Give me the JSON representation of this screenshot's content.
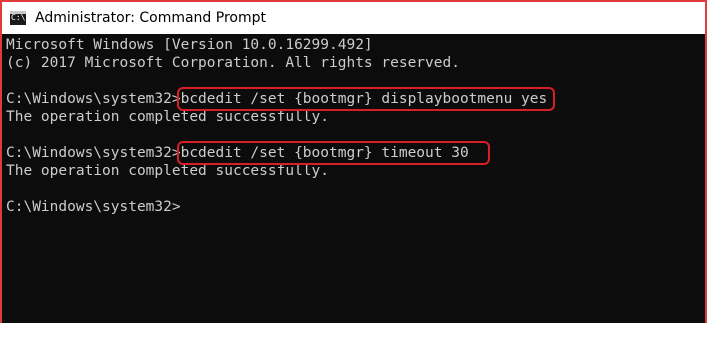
{
  "window": {
    "title": "Administrator: Command Prompt",
    "icon": "cmd-icon",
    "icon_glyph": "C:\\"
  },
  "console": {
    "lines": [
      "Microsoft Windows [Version 10.0.16299.492]",
      "(c) 2017 Microsoft Corporation. All rights reserved.",
      "",
      "C:\\Windows\\system32>bcdedit /set {bootmgr} displaybootmenu yes",
      "The operation completed successfully.",
      "",
      "C:\\Windows\\system32>bcdedit /set {bootmgr} timeout 30",
      "The operation completed successfully.",
      "",
      "C:\\Windows\\system32>"
    ]
  },
  "colors": {
    "highlight": "#d81f26",
    "console_bg": "#0c0c0c",
    "console_text": "#cccccc"
  }
}
